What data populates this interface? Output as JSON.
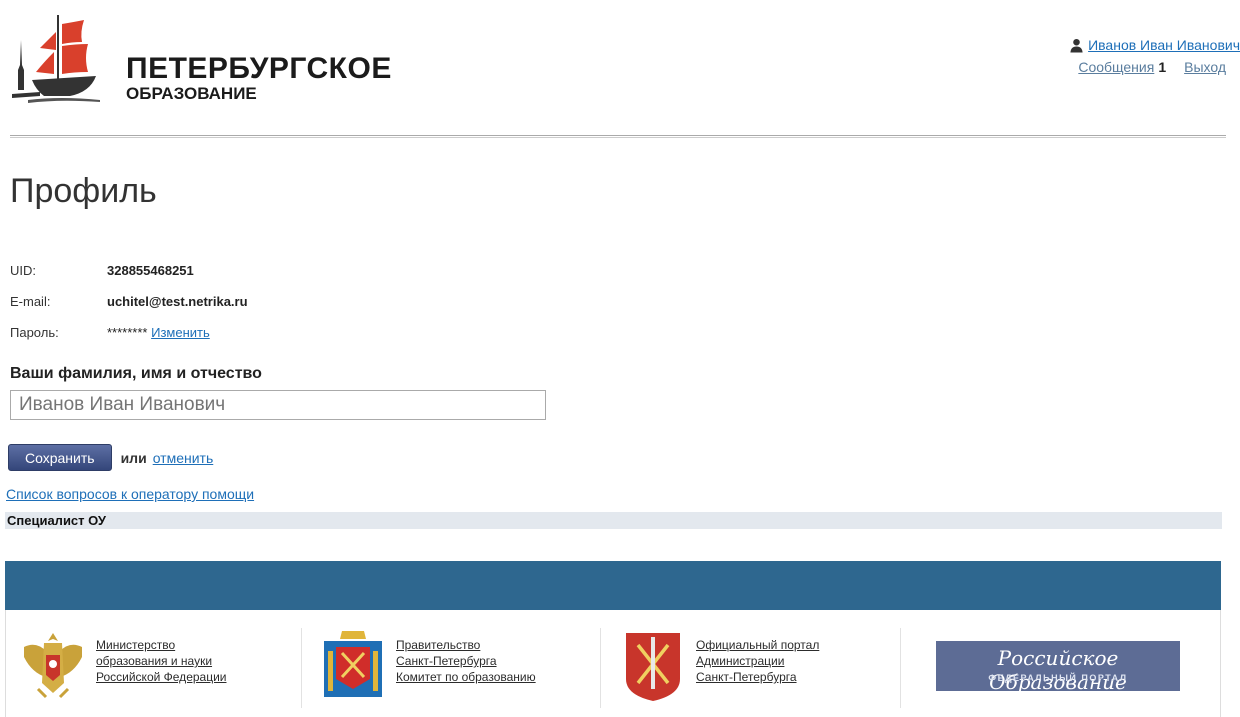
{
  "header": {
    "logo_line1": "ПЕТЕРБУРГСКОЕ",
    "logo_line2": "ОБРАЗОВАНИЕ",
    "user_name": "Иванов Иван Иванович",
    "messages_label": "Сообщения",
    "messages_count": "1",
    "logout_label": "Выход",
    "logo_color": "#d9402c"
  },
  "profile": {
    "title": "Профиль",
    "uid_label": "UID:",
    "uid_value": "328855468251",
    "email_label": "E-mail:",
    "email_value": "uchitel@test.netrika.ru",
    "password_label": "Пароль:",
    "password_mask": "********",
    "password_change_link": "Изменить",
    "fio_label": "Ваши фамилия, имя и отчество",
    "fio_placeholder": "Иванов Иван Иванович",
    "fio_value": "",
    "save_button": "Сохранить",
    "or_text": "или",
    "cancel_link": "отменить",
    "help_link": "Список вопросов к оператору помощи",
    "role": "Специалист ОУ"
  },
  "footer": {
    "band_color": "#2e678f",
    "links": [
      {
        "lines": [
          "Министерство",
          "образования и науки",
          "Российской Федерации"
        ],
        "icon": "russia-coat-of-arms-icon"
      },
      {
        "lines": [
          "Правительство",
          "Санкт-Петербурга",
          "Комитет по образованию"
        ],
        "icon": "spb-government-emblem-icon"
      },
      {
        "lines": [
          "Официальный портал",
          "Администрации",
          "Санкт-Петербурга"
        ],
        "icon": "spb-coat-of-arms-icon"
      }
    ],
    "banner_title": "Российское Образование",
    "banner_subtitle": "ФЕДЕРАЛЬНЫЙ ПОРТАЛ"
  }
}
